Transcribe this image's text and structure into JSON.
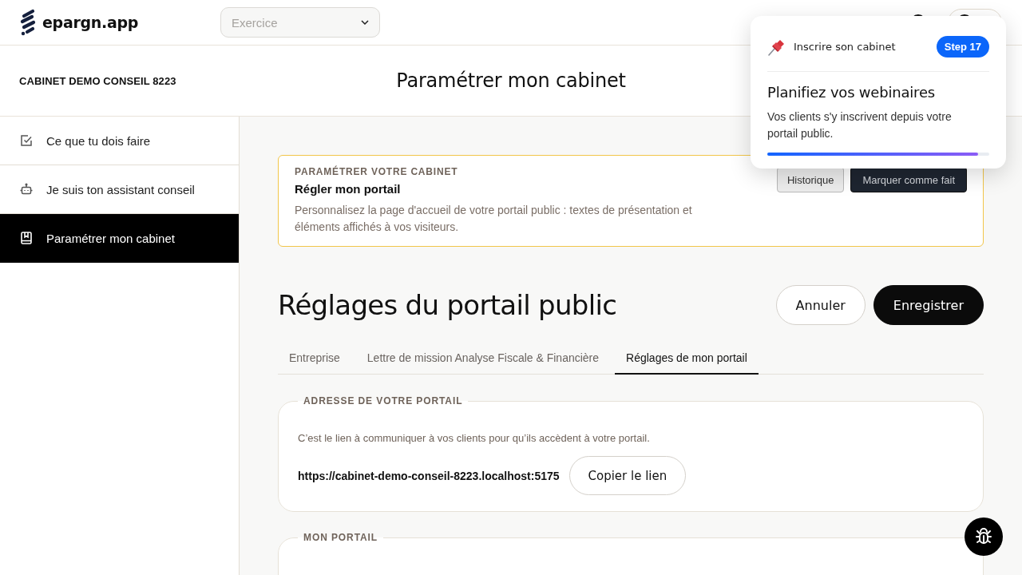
{
  "header": {
    "logo": "epargn.app",
    "exercise_select": {
      "placeholder": "Exercice"
    }
  },
  "subheader": {
    "firm_name": "CABINET DEMO CONSEIL 8223",
    "title": "Paramétrer mon cabinet"
  },
  "sidebar": {
    "items": [
      {
        "label": "Ce que tu dois faire",
        "kind": "todo",
        "selected": false
      },
      {
        "label": "Je suis ton assistant conseil",
        "kind": "assistant",
        "selected": false
      },
      {
        "label": "Paramétrer mon cabinet",
        "kind": "settings",
        "selected": true
      }
    ]
  },
  "task_card": {
    "eyebrow": "PARAMÉTRER VOTRE CABINET",
    "title": "Régler mon portail",
    "description": "Personnalisez la page d'accueil de votre portail public : textes de présentation et éléments affichés à vos visiteurs.",
    "buttons": [
      {
        "label": "Historique",
        "kind": "secondary"
      },
      {
        "label": "Marquer comme fait",
        "kind": "primary"
      }
    ]
  },
  "page": {
    "heading": "Réglages du portail public",
    "buttons": [
      {
        "label": "Annuler",
        "kind": "secondary"
      },
      {
        "label": "Enregistrer",
        "kind": "primary"
      }
    ]
  },
  "tabs": [
    {
      "label": "Entreprise",
      "selected": false
    },
    {
      "label": "Lettre de mission Analyse Fiscale & Financière",
      "selected": false
    },
    {
      "label": "Réglages de mon portail",
      "selected": true
    }
  ],
  "sections": [
    {
      "legend": "ADRESSE DE VOTRE PORTAIL",
      "hint": "C’est le lien à communiquer à vos clients pour qu’ils accèdent à votre portail.",
      "url": "https://cabinet-demo-conseil-8223.localhost:5175",
      "button": "Copier le lien"
    },
    {
      "legend": "MON PORTAIL"
    }
  ],
  "tour_popover": {
    "section": "Inscrire son cabinet",
    "step": "Step 17",
    "title": "Planifiez vos webinaires",
    "text": "Vos clients s'y inscrivent depuis votre portail public.",
    "level": 0.95
  }
}
